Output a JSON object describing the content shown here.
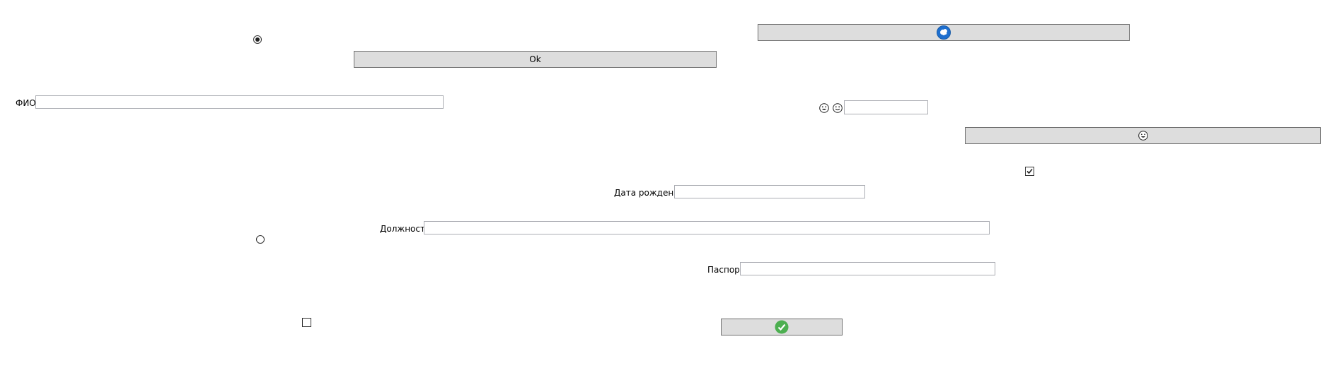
{
  "labels": {
    "fio": "ФИО",
    "birth_date": "Дата рождения",
    "position": "Должность",
    "passport": "Паспорт"
  },
  "buttons": {
    "ok_label": "Ok",
    "top_right_icon": "blue-globe-icon",
    "emoji_button_icon": "smiley-face-icon",
    "confirm_icon": "green-checkmark-icon"
  },
  "fields": {
    "fio_value": "",
    "birth_date_value": "",
    "position_value": "",
    "passport_value": "",
    "small_value": ""
  },
  "radios": {
    "first_selected": true,
    "second_selected": false
  },
  "checkboxes": {
    "right_checked": true,
    "left_checked": false
  },
  "icons": {
    "emoji_1": "grinning-face-icon",
    "emoji_2": "smiling-face-icon"
  },
  "colors": {
    "button_bg": "#dddddd",
    "button_border": "#707070",
    "field_border": "#abadb3",
    "globe_blue": "#1e6fcf",
    "check_green": "#4caf50"
  }
}
